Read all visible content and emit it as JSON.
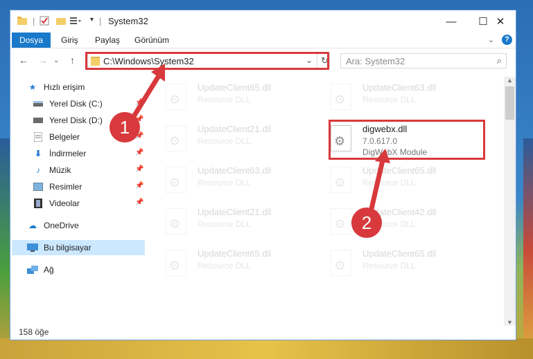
{
  "window": {
    "title": "System32"
  },
  "ribbon": {
    "tabs": [
      "Dosya",
      "Giriş",
      "Paylaş",
      "Görünüm"
    ]
  },
  "address": {
    "path": "C:\\Windows\\System32"
  },
  "search": {
    "placeholder": "Ara: System32"
  },
  "nav": {
    "quick_access": "Hızlı erişim",
    "items": [
      "Yerel Disk (C:)",
      "Yerel Disk (D:)",
      "Belgeler",
      "İndirmeler",
      "Müzik",
      "Resimler",
      "Videolar"
    ],
    "onedrive": "OneDrive",
    "this_pc": "Bu bilgisayar",
    "network": "Ağ"
  },
  "files": {
    "left": [
      {
        "name": "UpdateClient65.dll",
        "type": "Resource DLL"
      },
      {
        "name": "UpdateClient21.dll",
        "type": "Resource DLL"
      },
      {
        "name": "UpdateClient63.dll",
        "type": "Resource DLL"
      },
      {
        "name": "UpdateClient21.dll",
        "type": "Resource DLL"
      },
      {
        "name": "UpdateClient65.dll",
        "type": "Resource DLL"
      }
    ],
    "right": [
      {
        "name": "UpdateClient63.dll",
        "type": "Resource DLL"
      },
      {
        "name": "UpdateClient65.dll",
        "type": "Resource DLL"
      },
      {
        "name": "UpdateClient42.dll",
        "type": "Resource DLL"
      },
      {
        "name": "UpdateClient65.dll",
        "type": "Resource DLL"
      }
    ],
    "highlight": {
      "name": "digwebx.dll",
      "version": "7.0.617.0",
      "description": "DigWebX Module"
    }
  },
  "status": {
    "count": "158 öğe"
  },
  "markers": [
    "1",
    "2"
  ],
  "colors": {
    "accent": "#1979ca",
    "highlight": "#d8393c"
  }
}
